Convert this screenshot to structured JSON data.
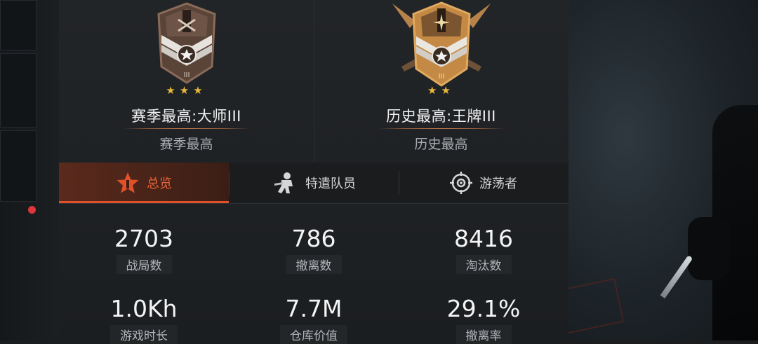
{
  "ranks": [
    {
      "title": "赛季最高:大师III",
      "subtitle": "赛季最高",
      "stars": "★★★"
    },
    {
      "title": "历史最高:王牌III",
      "subtitle": "历史最高",
      "stars": "★★"
    }
  ],
  "tabs": [
    {
      "label": "总览",
      "icon": "star-rank-icon",
      "active": true
    },
    {
      "label": "特遣队员",
      "icon": "operator-icon",
      "active": false
    },
    {
      "label": "游荡者",
      "icon": "crosshair-icon",
      "active": false
    }
  ],
  "stats": [
    {
      "value": "2703",
      "label": "战局数"
    },
    {
      "value": "786",
      "label": "撤离数"
    },
    {
      "value": "8416",
      "label": "淘汰数"
    },
    {
      "value": "1.0Kh",
      "label": "游戏时长"
    },
    {
      "value": "7.7M",
      "label": "仓库价值"
    },
    {
      "value": "29.1%",
      "label": "撤离率"
    }
  ],
  "colors": {
    "accent": "#e0512a",
    "gold": "#e9b839"
  }
}
